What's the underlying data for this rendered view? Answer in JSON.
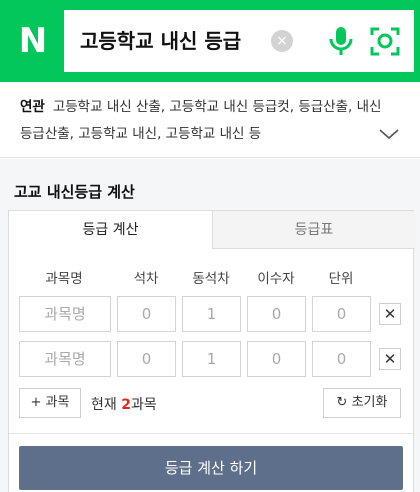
{
  "header": {
    "logo": "N",
    "query": "고등학교 내신 등급",
    "clear_glyph": "×",
    "brand_color": "#03c75a"
  },
  "related": {
    "label": "연관",
    "text": "고등학교 내신 산출, 고등학교 내신 등급컷, 등급산출, 내신등급산출, 고등학교 내신, 고등학교 내신 등"
  },
  "calculator": {
    "title": "고교 내신등급 계산",
    "tabs": [
      {
        "label": "등급 계산",
        "active": true
      },
      {
        "label": "등급표",
        "active": false
      }
    ],
    "columns": [
      "과목명",
      "석차",
      "동석차",
      "이수자",
      "단위"
    ],
    "rows": [
      {
        "name_placeholder": "과목명",
        "rank": "0",
        "tie": "1",
        "students": "0",
        "units": "0"
      },
      {
        "name_placeholder": "과목명",
        "rank": "0",
        "tie": "1",
        "students": "0",
        "units": "0"
      }
    ],
    "delete_glyph": "✕",
    "add_label": "+ 과목",
    "count_prefix": "현재 ",
    "count_value": "2",
    "count_suffix": "과목",
    "reset_label": "↻ 초기화",
    "submit_label": "등급 계산 하기",
    "submit_color": "#5d6f8a",
    "count_color": "#e1261c"
  }
}
